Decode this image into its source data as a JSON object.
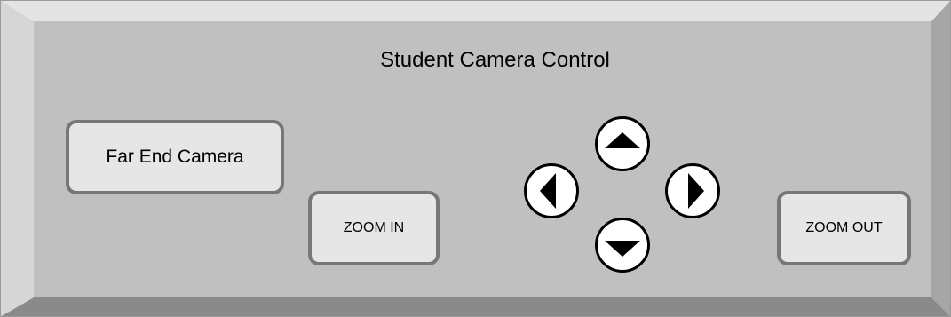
{
  "panel": {
    "title": "Student Camera Control"
  },
  "buttons": {
    "far_end_camera": "Far End Camera",
    "zoom_in": "ZOOM IN",
    "zoom_out": "ZOOM OUT"
  },
  "pan_tilt": {
    "up_icon": "triangle-up-icon",
    "down_icon": "triangle-down-icon",
    "left_icon": "triangle-left-icon",
    "right_icon": "triangle-right-icon"
  },
  "colors": {
    "panel_face": "#c0c0c0",
    "bevel_light": "#e4e4e4",
    "bevel_dark": "#8a8a8a",
    "button_face": "#e6e6e6",
    "button_border": "#777777"
  }
}
